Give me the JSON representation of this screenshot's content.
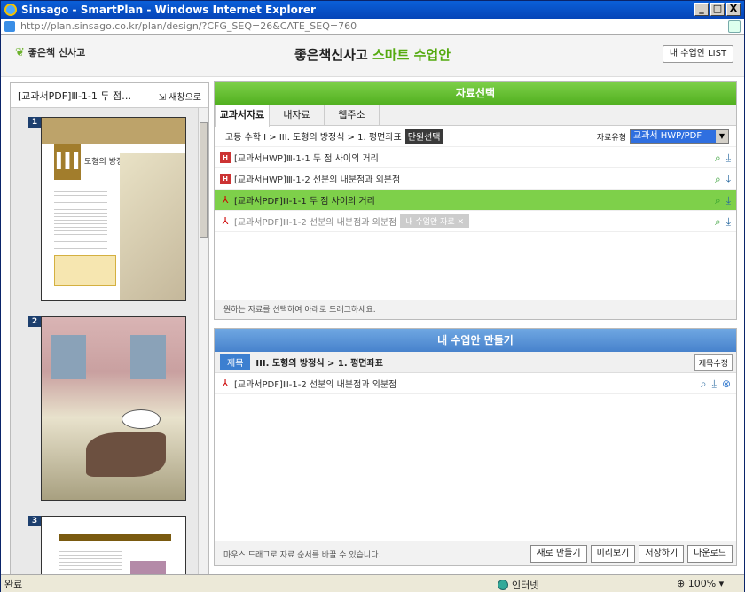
{
  "window": {
    "title": "Sinsago - SmartPlan - Windows Internet Explorer",
    "minimize": "_",
    "maximize": "□",
    "close": "X"
  },
  "address": {
    "url": "http://plan.sinsago.co.kr/plan/design/?CFG_SEQ=26&CATE_SEQ=760"
  },
  "header": {
    "logo": "좋은책 신사고",
    "brand_main": "좋은책신사고",
    "brand_accent": "스마트 수업안",
    "list_button": "내 수업안 LIST"
  },
  "left": {
    "title": "[교과서PDF]Ⅲ-1-1 두 점…",
    "new_window": "새창으로",
    "pages": [
      "1",
      "2",
      "3"
    ],
    "page1_heading": "도형의 방정식",
    "page1_roman": "III"
  },
  "select_panel": {
    "title": "자료선택",
    "tabs": [
      "교과서자료",
      "내자료",
      "웹주소"
    ],
    "breadcrumb": "고등 수학 I > III. 도형의 방정식 > 1. 평면좌표",
    "unit_button": "단원선택",
    "type_label": "자료유형",
    "type_value": "교과서 HWP/PDF",
    "items": [
      {
        "label": "[교과서HWP]Ⅲ-1-1 두 점 사이의 거리",
        "kind": "hwp"
      },
      {
        "label": "[교과서HWP]Ⅲ-1-2 선분의 내분점과 외분점",
        "kind": "hwp"
      },
      {
        "label": "[교과서PDF]Ⅲ-1-1 두 점 사이의 거리",
        "kind": "pdf"
      },
      {
        "label": "[교과서PDF]Ⅲ-1-2 선분의 내분점과 외분점",
        "kind": "pdf",
        "tag": "내 수업안 자료"
      }
    ],
    "footer": "원하는 자료를 선택하여 아래로 드래그하세요."
  },
  "make_panel": {
    "title": "내 수업안 만들기",
    "title_badge": "제목",
    "title_text": "III. 도형의 방정식 > 1. 평면좌표",
    "edit_button": "제목수정",
    "items": [
      {
        "label": "[교과서PDF]Ⅲ-1-2 선분의 내분점과 외분점"
      }
    ],
    "footer_hint": "마우스 드래그로 자료 순서를 바꿀 수 있습니다.",
    "buttons": [
      "새로 만들기",
      "미리보기",
      "저장하기",
      "다운로드"
    ]
  },
  "status": {
    "text": "완료",
    "zone": "인터넷",
    "zoom": "100%"
  },
  "colors": {
    "accent_green": "#55aa10",
    "select_header": "#52b020",
    "make_header": "#4782cc",
    "highlight": "#7ed04a"
  }
}
